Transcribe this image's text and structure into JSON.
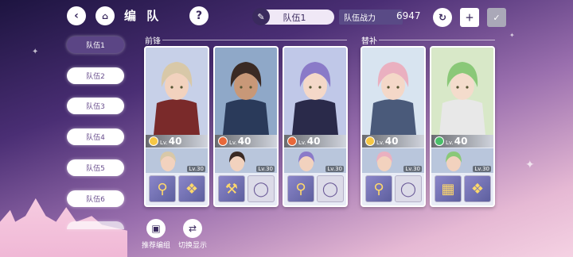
{
  "header": {
    "title": "编 队",
    "team_name": "队伍1",
    "power_label": "队伍战力",
    "power_value": "6947"
  },
  "tabs": [
    "队伍1",
    "队伍2",
    "队伍3",
    "队伍4",
    "队伍5",
    "队伍6"
  ],
  "sections": {
    "front": "前锋",
    "sub": "替补"
  },
  "cards": [
    {
      "level": "40",
      "sub_level": "Lv.30",
      "lv_prefix": "Lv.",
      "hair": "#d8c8a8",
      "coat": "#7a2a2a",
      "skin": "#f2d2be",
      "bg": "#c7d0e8",
      "elem": "#f6c744"
    },
    {
      "level": "40",
      "sub_level": "Lv.30",
      "lv_prefix": "Lv.",
      "hair": "#3a2a24",
      "coat": "#2a3a5a",
      "skin": "#c89878",
      "bg": "#8fa8c8",
      "elem": "#e8683a"
    },
    {
      "level": "40",
      "sub_level": "Lv.30",
      "lv_prefix": "Lv.",
      "hair": "#8a7ac8",
      "coat": "#2a2a4a",
      "skin": "#f4d8c8",
      "bg": "#c0c8e8",
      "elem": "#e8683a"
    },
    {
      "level": "40",
      "sub_level": "Lv.30",
      "lv_prefix": "Lv.",
      "hair": "#eab0c0",
      "coat": "#4a5a7a",
      "skin": "#f4d8c8",
      "bg": "#d8e4f0",
      "elem": "#f6c744"
    },
    {
      "level": "40",
      "sub_level": "Lv.30",
      "lv_prefix": "Lv.",
      "hair": "#8ac878",
      "coat": "#e8e8e8",
      "skin": "#f4dccc",
      "bg": "#d8e8c8",
      "elem": "#4abe6a"
    }
  ],
  "bottom": {
    "recommend": "推荐编组",
    "switch": "切换显示"
  }
}
